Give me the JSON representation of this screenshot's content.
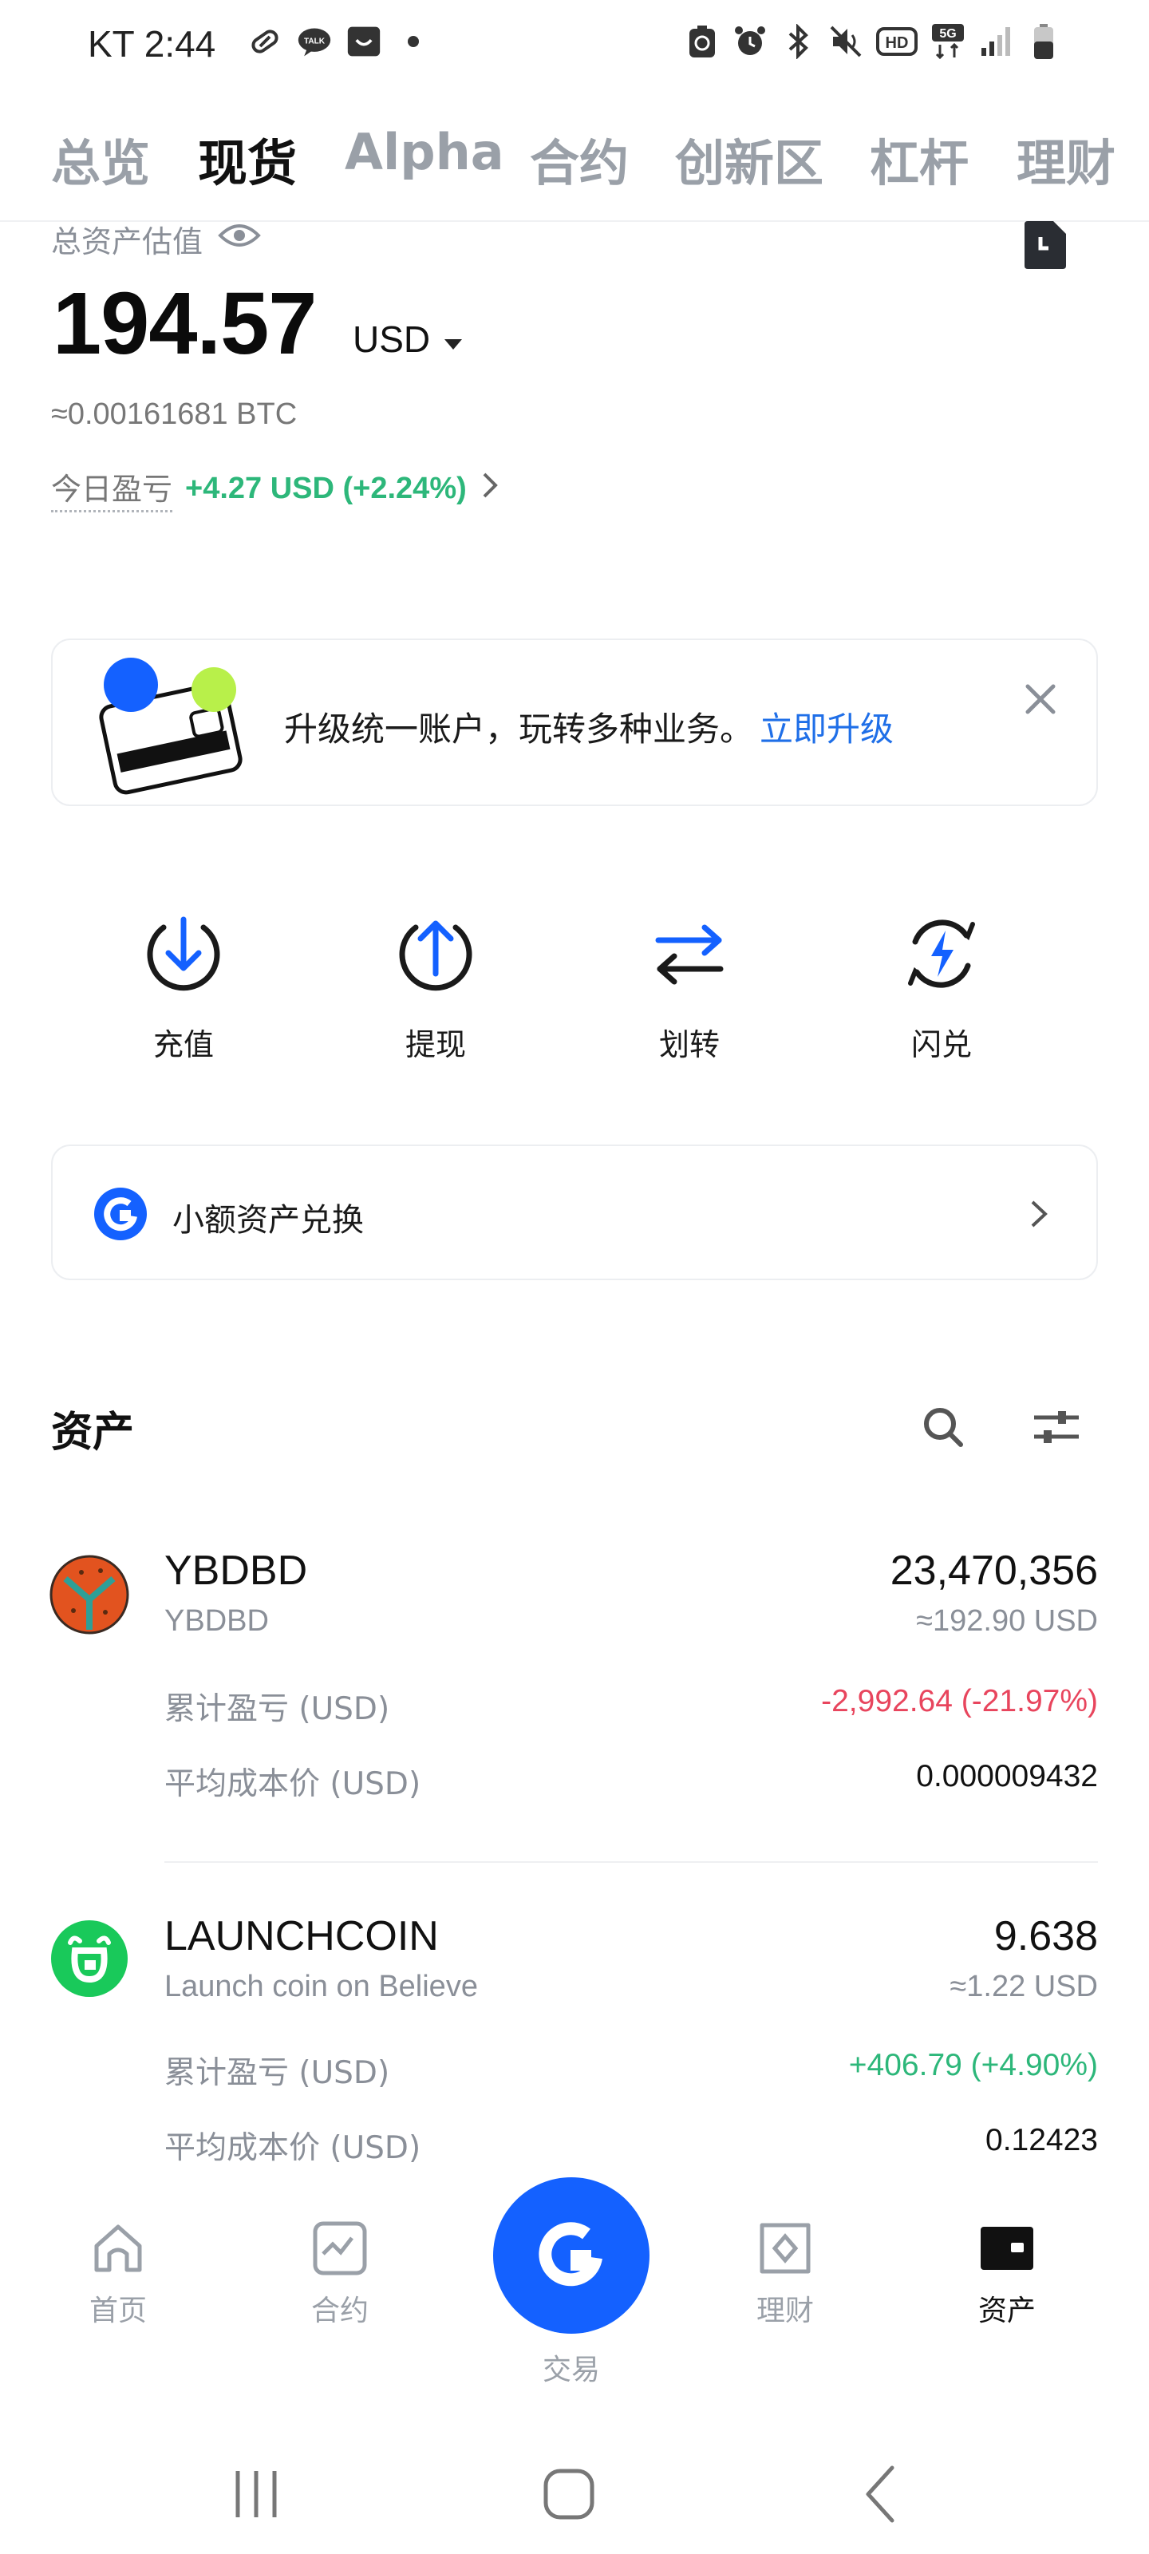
{
  "status_bar": {
    "time": "KT 2:44",
    "icons": [
      "link-icon",
      "talk-icon",
      "bag-icon",
      "dot-icon",
      "recycle-icon",
      "alarm-icon",
      "bluetooth-icon",
      "mute-icon",
      "hd-icon",
      "5g-icon",
      "signal-icon",
      "battery-icon"
    ],
    "hd_label": "HD",
    "fiveg_label": "5G"
  },
  "tabs": [
    {
      "label": "总览",
      "active": false
    },
    {
      "label": "现货",
      "active": true
    },
    {
      "label": "Alpha",
      "active": false
    },
    {
      "label": "合约",
      "active": false
    },
    {
      "label": "创新区",
      "active": false
    },
    {
      "label": "杠杆",
      "active": false
    },
    {
      "label": "理财",
      "active": false
    }
  ],
  "balance": {
    "label": "总资产估值",
    "amount": "194.57",
    "currency": "USD",
    "btc": "≈0.00161681 BTC",
    "pnl_label": "今日盈亏",
    "pnl_value": "+4.27 USD (+2.24%)"
  },
  "upgrade": {
    "text": "升级统一账户，玩转多种业务。",
    "link": "立即升级"
  },
  "actions": [
    {
      "label": "充值",
      "icon": "deposit-icon"
    },
    {
      "label": "提现",
      "icon": "withdraw-icon"
    },
    {
      "label": "划转",
      "icon": "transfer-icon"
    },
    {
      "label": "闪兑",
      "icon": "flash-convert-icon"
    }
  ],
  "convert": {
    "label": "小额资产兑换"
  },
  "assets": {
    "title": "资产",
    "items": [
      {
        "symbol": "YBDBD",
        "name": "YBDBD",
        "amount": "23,470,356",
        "usd": "≈192.90 USD",
        "pnl_label": "累计盈亏 (USD)",
        "pnl": "-2,992.64 (-21.97%)",
        "cost_label": "平均成本价 (USD)",
        "cost": "0.000009432"
      },
      {
        "symbol": "LAUNCHCOIN",
        "name": "Launch coin on Believe",
        "amount": "9.638",
        "usd": "≈1.22 USD",
        "pnl_label": "累计盈亏 (USD)",
        "pnl": "+406.79 (+4.90%)",
        "cost_label": "平均成本价 (USD)",
        "cost": "0.12423"
      }
    ]
  },
  "bottom_nav": [
    {
      "label": "首页",
      "icon": "home-icon"
    },
    {
      "label": "合约",
      "icon": "futures-icon"
    },
    {
      "label": "交易",
      "icon": "trade-icon"
    },
    {
      "label": "理财",
      "icon": "earn-icon"
    },
    {
      "label": "资产",
      "icon": "wallet-icon"
    }
  ],
  "colors": {
    "accent": "#1461ff",
    "positive": "#2db77a",
    "negative": "#e8455d",
    "link": "#1f6fe8"
  }
}
